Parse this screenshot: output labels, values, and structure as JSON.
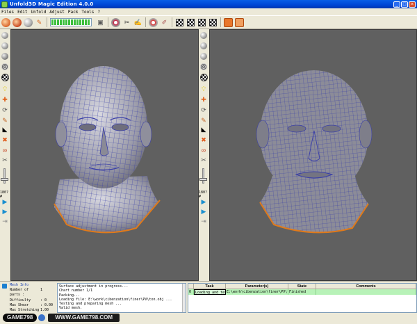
{
  "app": {
    "title": "Unfold3D Magic Edition 4.0.0",
    "window_buttons": [
      "_",
      "□",
      "×"
    ]
  },
  "menu": [
    "Files",
    "Edit",
    "Unfold",
    "Adjust",
    "Pack",
    "Tools",
    "?"
  ],
  "side": {
    "percent_label_left": "180?#",
    "percent_label_mid": "180?#"
  },
  "mesh_info": {
    "title": "Mesh Info",
    "rows": [
      {
        "label": "Number of parts :",
        "value": "1"
      },
      {
        "label": "Difficulty",
        "value": ": 0"
      },
      {
        "label": "Max Shear",
        "value": ": 0.00"
      },
      {
        "label": "Max Stretching :",
        "value": "1.00"
      }
    ]
  },
  "log": {
    "lines": [
      "Surface adjustment in progress...",
      "Chart number 1/1",
      "Packing...",
      "Loading file: E:\\work\\cibenzation\\finer\\PV\\ton.obj ...",
      "Testing and preparing mesh ...",
      "Valid mesh."
    ]
  },
  "tasks": {
    "columns": [
      "",
      "Task",
      "Parameter(s)",
      "State",
      "Comments"
    ],
    "rows": [
      [
        "0",
        "Loading and tes",
        "E:\\work\\cibenzation\\finer\\PV\\ton",
        "Finished",
        ""
      ]
    ]
  },
  "watermark": {
    "left": "GAME798",
    "right": "WWW.GAME798.COM"
  },
  "colors": {
    "viewport_bg": "#606060",
    "mesh_wire": "#3a3fa8",
    "boundary": "#e07a1a",
    "progress": "#3cbf3c"
  }
}
